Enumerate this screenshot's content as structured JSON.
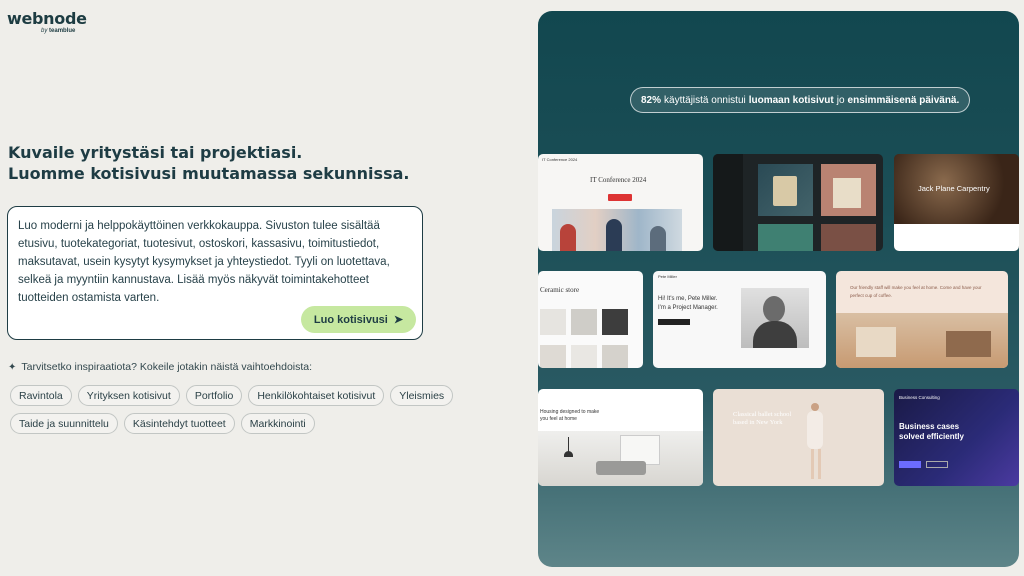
{
  "logo": {
    "name": "webnode",
    "sub_by": "by",
    "sub_brand": "teamblue"
  },
  "headline": {
    "line1": "Kuvaile yritystäsi tai projektiasi.",
    "line2": "Luomme kotisivusi muutamassa sekunnissa."
  },
  "prompt": {
    "text": "Luo moderni ja helppokäyttöinen verkkokauppa. Sivuston tulee sisältää etusivu, tuotekategoriat, tuotesivut, ostoskori, kassasivu, toimitustiedot, maksutavat, usein kysytyt kysymykset ja yhteystiedot. Tyyli on luotettava, selkeä ja myyntiin kannustava. Lisää myös näkyvät toimintakehotteet tuotteiden ostamista varten.",
    "button_label": "Luo kotisivusi",
    "button_icon": "➤"
  },
  "inspiration": {
    "icon": "✦",
    "label": "Tarvitsetko inspiraatiota? Kokeile jotakin näistä vaihtoehdoista:",
    "chips": [
      "Ravintola",
      "Yrityksen kotisivut",
      "Portfolio",
      "Henkilökohtaiset kotisivut",
      "Yleismies",
      "Taide ja suunnittelu",
      "Käsintehdyt tuotteet",
      "Markkinointi"
    ]
  },
  "panel": {
    "stat": {
      "pct": "82%",
      "text1": "käyttäjistä onnistui",
      "bold1": "luomaan kotisivut",
      "text2": "jo",
      "bold2": "ensimmäisenä päivänä."
    },
    "thumbs": {
      "conference_nav": "IT Conference 2024",
      "conference_title": "IT Conference 2024",
      "carpentry": "Jack Plane Carpentry",
      "ceramic": "Ceramic store",
      "pm_nav": "Pete Miller",
      "pm_line1": "Hi! It's me, Pete Miller.",
      "pm_line2": "I'm a Project Manager.",
      "cafe": "Our friendly staff will make you feel at home. Come and have your perfect cup of coffee.",
      "housing": "Housing designed to make you feel at home",
      "ballet": "Classical ballet school based in New York",
      "business_line1": "Business cases",
      "business_line2": "solved efficiently",
      "business_nav": "Business Consulting"
    }
  },
  "colors": {
    "accent_button": "#c6e8a0",
    "panel_top": "#12474f",
    "heading": "#1e3c44"
  }
}
